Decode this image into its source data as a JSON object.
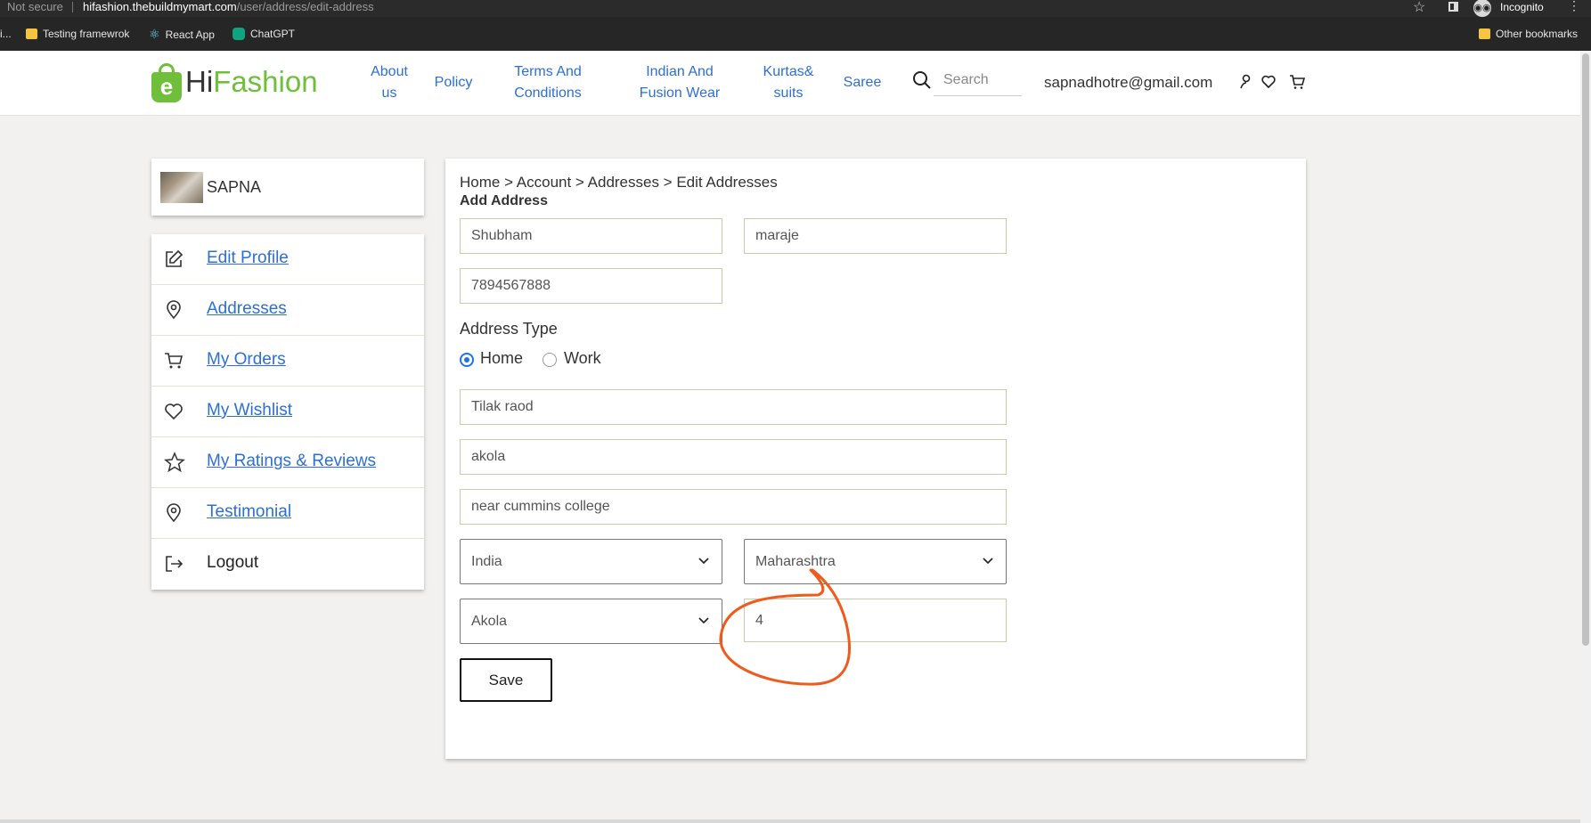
{
  "browser": {
    "security": "Not secure",
    "url_host": "hifashion.thebuildmymart.com",
    "url_path": "/user/address/edit-address",
    "mode": "Incognito",
    "bookmarks": [
      {
        "label": "i...",
        "icon": "folder-icon"
      },
      {
        "label": "Testing framewrok",
        "icon": "folder-icon"
      },
      {
        "label": "React App",
        "icon": "react-icon"
      },
      {
        "label": "ChatGPT",
        "icon": "chatgpt-icon"
      }
    ],
    "other_bookmarks": "Other bookmarks"
  },
  "header": {
    "logo_hi": "Hi",
    "logo_fashion": "Fashion",
    "logo_letter": "e",
    "nav": [
      {
        "label": "About us"
      },
      {
        "label": "Policy"
      },
      {
        "label": "Terms And Conditions"
      },
      {
        "label": "Indian And Fusion Wear"
      },
      {
        "label": "Kurtas& suits"
      },
      {
        "label": "Saree"
      }
    ],
    "search_placeholder": "Search",
    "email": "sapnadhotre@gmail.com"
  },
  "profile": {
    "name": "SAPNA"
  },
  "sidebar": {
    "items": [
      {
        "label": "Edit Profile",
        "icon": "edit-icon"
      },
      {
        "label": "Addresses",
        "icon": "location-pin-icon"
      },
      {
        "label": "My Orders",
        "icon": "cart-icon"
      },
      {
        "label": "My Wishlist",
        "icon": "heart-icon"
      },
      {
        "label": "My Ratings & Reviews",
        "icon": "star-icon"
      },
      {
        "label": "Testimonial",
        "icon": "location-pin-icon"
      },
      {
        "label": "Logout",
        "icon": "logout-icon"
      }
    ]
  },
  "form": {
    "breadcrumb": "Home > Account > Addresses > Edit Addresses",
    "title": "Add Address",
    "first_name": "Shubham",
    "last_name": "maraje",
    "phone": "7894567888",
    "address_type_label": "Address Type",
    "address_type_options": [
      "Home",
      "Work"
    ],
    "address_type_selected": "Home",
    "address_line1": "Tilak raod",
    "address_line2": "akola",
    "landmark": "near cummins college",
    "country": "India",
    "state": "Maharashtra",
    "city": "Akola",
    "pincode": "4",
    "save_label": "Save"
  },
  "annotation_color": "#f05a1a"
}
